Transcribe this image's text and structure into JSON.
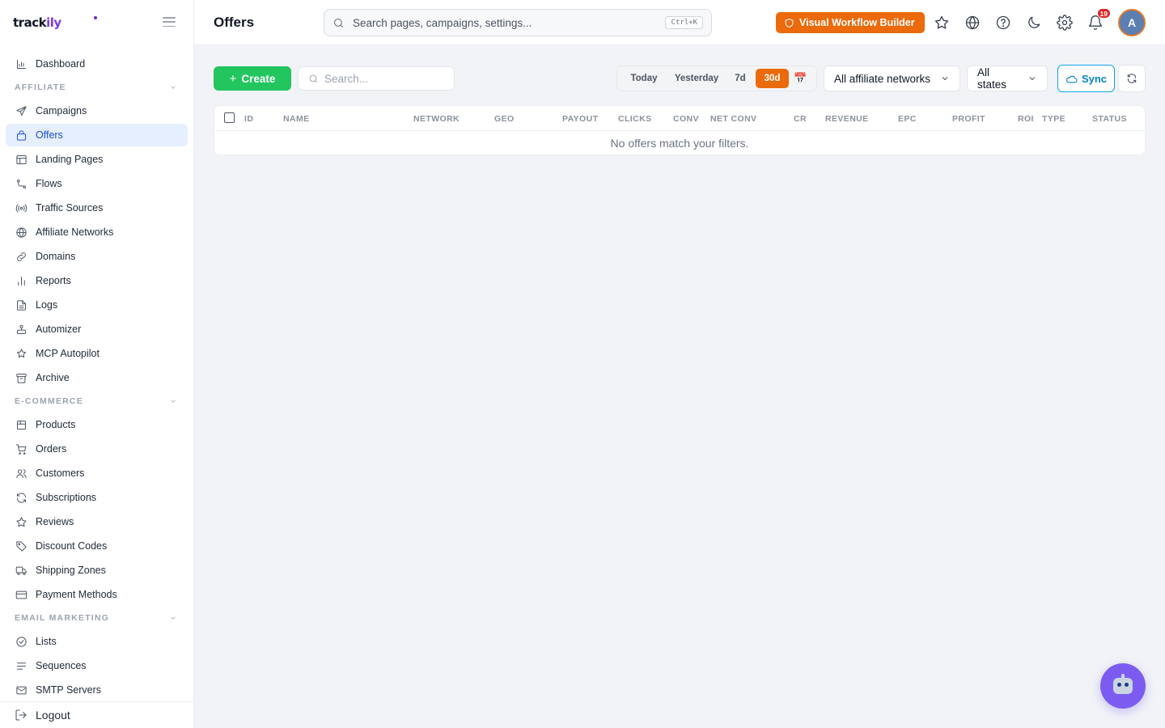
{
  "brand": {
    "logo_main": "track",
    "logo_accent": "ily"
  },
  "header": {
    "title": "Offers",
    "search_placeholder": "Search pages, campaigns, settings...",
    "search_shortcut": "Ctrl+K",
    "workflow_button": "Visual Workflow Builder",
    "notifications_count": "19",
    "avatar_initial": "A"
  },
  "sidebar": {
    "top_items": [
      {
        "label": "Dashboard",
        "icon": "bar-chart-icon"
      }
    ],
    "sections": [
      {
        "title": "AFFILIATE",
        "items": [
          {
            "label": "Campaigns",
            "icon": "send-icon"
          },
          {
            "label": "Offers",
            "icon": "lock-bag-icon",
            "active": true
          },
          {
            "label": "Landing Pages",
            "icon": "layout-icon"
          },
          {
            "label": "Flows",
            "icon": "route-icon"
          },
          {
            "label": "Traffic Sources",
            "icon": "radio-icon"
          },
          {
            "label": "Affiliate Networks",
            "icon": "globe-icon"
          },
          {
            "label": "Domains",
            "icon": "link-icon"
          },
          {
            "label": "Reports",
            "icon": "reports-icon"
          },
          {
            "label": "Logs",
            "icon": "file-text-icon"
          },
          {
            "label": "Automizer",
            "icon": "automizer-icon"
          },
          {
            "label": "MCP Autopilot",
            "icon": "sparkle-star-icon"
          },
          {
            "label": "Archive",
            "icon": "archive-icon"
          }
        ]
      },
      {
        "title": "E-COMMERCE",
        "items": [
          {
            "label": "Products",
            "icon": "box-icon"
          },
          {
            "label": "Orders",
            "icon": "cart-icon"
          },
          {
            "label": "Customers",
            "icon": "users-icon"
          },
          {
            "label": "Subscriptions",
            "icon": "refresh-icon"
          },
          {
            "label": "Reviews",
            "icon": "star-icon"
          },
          {
            "label": "Discount Codes",
            "icon": "tag-icon"
          },
          {
            "label": "Shipping Zones",
            "icon": "truck-icon"
          },
          {
            "label": "Payment Methods",
            "icon": "credit-card-icon"
          }
        ]
      },
      {
        "title": "EMAIL MARKETING",
        "items": [
          {
            "label": "Lists",
            "icon": "check-circle-icon"
          },
          {
            "label": "Sequences",
            "icon": "lines-icon"
          },
          {
            "label": "SMTP Servers",
            "icon": "mail-icon"
          }
        ]
      }
    ],
    "logout_label": "Logout"
  },
  "toolbar": {
    "create_label": "Create",
    "search_placeholder": "Search...",
    "date_ranges": [
      "Today",
      "Yesterday",
      "7d",
      "30d"
    ],
    "active_range": "30d",
    "network_filter": "All affiliate networks",
    "state_filter": "All states",
    "sync_label": "Sync"
  },
  "table": {
    "columns": [
      "ID",
      "NAME",
      "NETWORK",
      "GEO",
      "PAYOUT",
      "CLICKS",
      "CONV",
      "NET CONV",
      "CR",
      "REVENUE",
      "EPC",
      "PROFIT",
      "ROI",
      "TYPE",
      "STATUS"
    ],
    "empty_message": "No offers match your filters."
  },
  "colors": {
    "accent_orange": "#ea6a0c",
    "create_green": "#22c55e",
    "active_nav_bg": "#e5efff",
    "active_nav_text": "#1d4ed8",
    "sync_blue": "#0284c7",
    "bot_purple": "#7c5cf0",
    "badge_red": "#dc2626"
  }
}
